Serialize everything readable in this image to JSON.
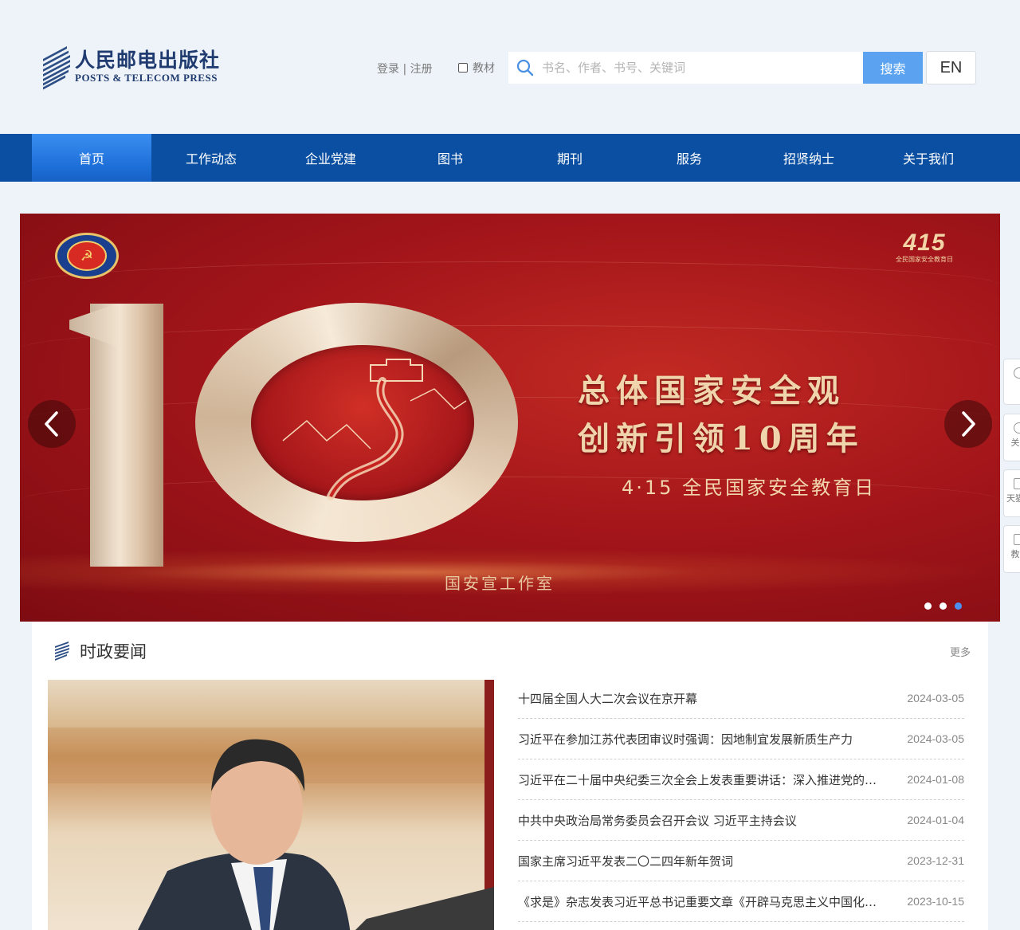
{
  "header": {
    "logo_cn": "人民邮电出版社",
    "logo_en": "POSTS & TELECOM PRESS",
    "login": "登录",
    "separator": "|",
    "register": "注册",
    "textbook_label": "教材",
    "textbook_checked": false,
    "search": {
      "placeholder": "书名、作者、书号、关键词",
      "value": "",
      "button": "搜索"
    },
    "lang_button": "EN"
  },
  "nav": {
    "active_index": 0,
    "items": [
      {
        "label": "首页"
      },
      {
        "label": "工作动态"
      },
      {
        "label": "企业党建"
      },
      {
        "label": "图书"
      },
      {
        "label": "期刊"
      },
      {
        "label": "服务"
      },
      {
        "label": "招贤纳士"
      },
      {
        "label": "关于我们"
      }
    ]
  },
  "banner": {
    "badge_number": "415",
    "badge_sub": "全民国家安全教育日",
    "big_number": "10",
    "title_line1": "总体国家安全观",
    "title_line2": "创新引领10周年",
    "subtitle": "4·15 全民国家安全教育日",
    "credit": "国安宣工作室",
    "slides_count": 3,
    "active_slide": 2
  },
  "side_tools": [
    {
      "label": ""
    },
    {
      "label": "关"
    },
    {
      "label": "天猫"
    },
    {
      "label": "教"
    }
  ],
  "news": {
    "title": "时政要闻",
    "more": "更多",
    "items": [
      {
        "title": "十四届全国人大二次会议在京开幕",
        "date": "2024-03-05"
      },
      {
        "title": "习近平在参加江苏代表团审议时强调：因地制宜发展新质生产力",
        "date": "2024-03-05"
      },
      {
        "title": "习近平在二十届中央纪委三次全会上发表重要讲话：深入推进党的自我革命",
        "date": "2024-01-08"
      },
      {
        "title": "中共中央政治局常务委员会召开会议 习近平主持会议",
        "date": "2024-01-04"
      },
      {
        "title": "国家主席习近平发表二〇二四年新年贺词",
        "date": "2023-12-31"
      },
      {
        "title": "《求是》杂志发表习近平总书记重要文章《开辟马克思主义中国化时代化新境界》",
        "date": "2023-10-15"
      }
    ]
  },
  "colors": {
    "nav_bg": "#0a4fa1",
    "nav_active": "#2a7fe8",
    "search_button": "#5ba3f0",
    "banner_red": "#a3151a",
    "banner_gold": "#f0d5ac",
    "dot_active": "#4c8ff0"
  },
  "icons": {
    "logo": "book-stack-icon",
    "search": "search-icon",
    "prev": "chevron-left-icon",
    "next": "chevron-right-icon",
    "section": "book-stack-icon"
  }
}
